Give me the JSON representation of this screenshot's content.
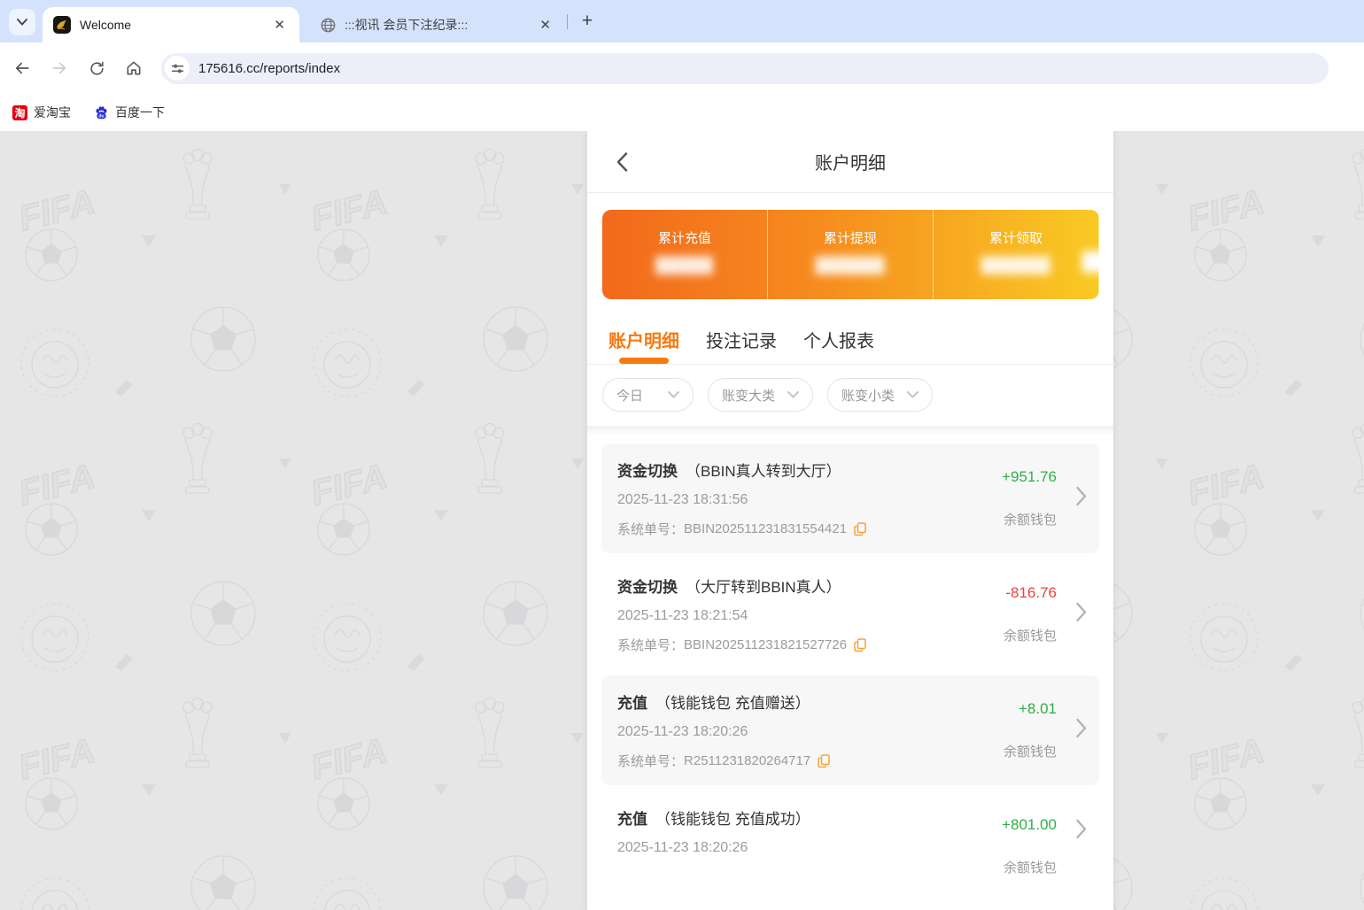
{
  "colors": {
    "accent_orange": "#f7790f",
    "positive_green": "#2eae4a",
    "negative_red": "#ee4040",
    "card_gradient_left": "#f2691c",
    "card_gradient_right": "#f9ca24",
    "tabstrip_blue": "#d5e2fb"
  },
  "browser": {
    "tabs": [
      {
        "title": "Welcome",
        "favicon": "gold-dragon-on-black"
      },
      {
        "title": ":::视讯 会员下注纪录:::",
        "favicon": "globe"
      }
    ],
    "url": "175616.cc/reports/index",
    "bookmarks": [
      {
        "label": "爱淘宝",
        "icon": "taobao-red-square",
        "icon_char": "淘"
      },
      {
        "label": "百度一下",
        "icon": "baidu-paw"
      }
    ]
  },
  "page": {
    "title": "账户明细",
    "summary_card": {
      "items": [
        {
          "label": "累计充值",
          "masked_value": "█████"
        },
        {
          "label": "累计提现",
          "masked_value": "██████"
        },
        {
          "label": "累计领取",
          "masked_value": "██████"
        }
      ],
      "partial_next_masked": "██"
    },
    "tabs": [
      {
        "label": "账户明细",
        "active": true
      },
      {
        "label": "投注记录",
        "active": false
      },
      {
        "label": "个人报表",
        "active": false
      }
    ],
    "filters": [
      {
        "label": "今日",
        "size": "w1"
      },
      {
        "label": "账变大类",
        "size": "w2"
      },
      {
        "label": "账变小类",
        "size": "w2"
      }
    ],
    "list": {
      "order_prefix": "系统单号："
    },
    "entries": [
      {
        "type": "资金切换",
        "detail": "（BBIN真人转到大厅）",
        "datetime": "2025-11-23 18:31:56",
        "order": "BBIN202511231831554421",
        "amount": "+951.76",
        "amount_color": "#2eae4a",
        "wallet": "余额钱包",
        "alt": true
      },
      {
        "type": "资金切换",
        "detail": "（大厅转到BBIN真人）",
        "datetime": "2025-11-23 18:21:54",
        "order": "BBIN202511231821527726",
        "amount": "-816.76",
        "amount_color": "#ee4040",
        "wallet": "余额钱包",
        "alt": false
      },
      {
        "type": "充值",
        "detail": "（钱能钱包 充值赠送）",
        "datetime": "2025-11-23 18:20:26",
        "order": "R2511231820264717",
        "amount": "+8.01",
        "amount_color": "#2eae4a",
        "wallet": "余额钱包",
        "alt": true
      },
      {
        "type": "充值",
        "detail": "（钱能钱包 充值成功）",
        "datetime": "2025-11-23 18:20:26",
        "order": null,
        "amount": "+801.00",
        "amount_color": "#2eae4a",
        "wallet": "余额钱包",
        "alt": false
      }
    ]
  }
}
